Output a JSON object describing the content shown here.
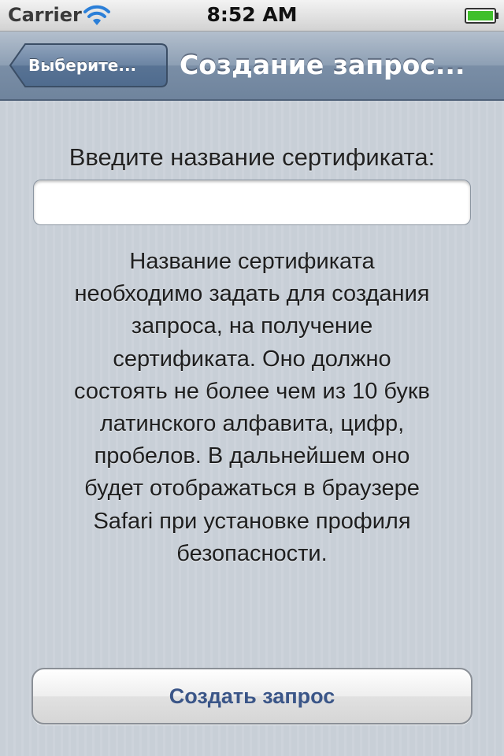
{
  "status_bar": {
    "carrier": "Carrier",
    "time": "8:52 AM",
    "wifi_icon": "wifi-icon",
    "battery_icon": "battery-icon",
    "battery_color": "#3fbf2b"
  },
  "nav_bar": {
    "back_label": "Выберите...",
    "title": "Создание запрос..."
  },
  "form": {
    "label": "Введите название сертификата:",
    "input_value": "",
    "input_placeholder": "",
    "description": "Название сертификата\nнеобходимо задать для создания\nзапроса, на получение\nсертификата. Оно должно\nсостоять не более чем из 10 букв\nлатинского алфавита, цифр,\nпробелов. В дальнейшем оно\nбудет отображаться в браузере\nSafari при установке профиля\nбезопасности."
  },
  "actions": {
    "create_label": "Создать запрос"
  },
  "colors": {
    "nav_bar": "#7a8ea6",
    "button_text": "#3b5688",
    "background": "#c8cfd7"
  }
}
